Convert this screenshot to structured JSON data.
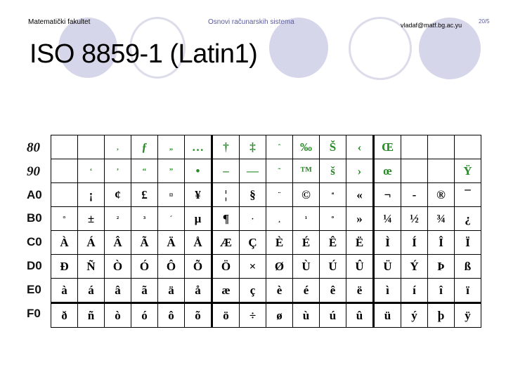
{
  "header": {
    "left": "Matematički fakultet",
    "center": "Osnovi računarskih sistema",
    "right": "vladaf@matf.bg.ac.yu",
    "page": "20/5"
  },
  "title": "ISO 8859-1 (Latin1)",
  "colors": {
    "accent_circle": "#d6d6ea",
    "cp1252_extension": "#2a8a2a",
    "text": "#000000"
  },
  "table": {
    "rows": [
      {
        "label": "80",
        "green": true,
        "cells": [
          "",
          "",
          "‚",
          "ƒ",
          "„",
          "…",
          "†",
          "‡",
          "ˆ",
          "‰",
          "Š",
          "‹",
          "Œ",
          "",
          "",
          ""
        ]
      },
      {
        "label": "90",
        "green": true,
        "cells": [
          "",
          "‘",
          "’",
          "“",
          "”",
          "•",
          "–",
          "—",
          "˜",
          "™",
          "š",
          "›",
          "œ",
          "",
          "",
          "Ÿ"
        ]
      },
      {
        "label": "A0",
        "green": false,
        "cells": [
          "",
          "¡",
          "¢",
          "£",
          "¤",
          "¥",
          "¦",
          "§",
          "¨",
          "©",
          "ª",
          "«",
          "¬",
          "-",
          "®",
          "¯"
        ]
      },
      {
        "label": "B0",
        "green": false,
        "cells": [
          "°",
          "±",
          "²",
          "³",
          "´",
          "µ",
          "¶",
          "·",
          "¸",
          "¹",
          "º",
          "»",
          "¼",
          "½",
          "¾",
          "¿"
        ]
      },
      {
        "label": "C0",
        "green": false,
        "cells": [
          "À",
          "Á",
          "Â",
          "Ã",
          "Ä",
          "Å",
          "Æ",
          "Ç",
          "È",
          "É",
          "Ê",
          "Ë",
          "Ì",
          "Í",
          "Î",
          "Ï"
        ]
      },
      {
        "label": "D0",
        "green": false,
        "cells": [
          "Ð",
          "Ñ",
          "Ò",
          "Ó",
          "Ô",
          "Õ",
          "Ö",
          "×",
          "Ø",
          "Ù",
          "Ú",
          "Û",
          "Ü",
          "Ý",
          "Þ",
          "ß"
        ]
      },
      {
        "label": "E0",
        "green": false,
        "cells": [
          "à",
          "á",
          "â",
          "ã",
          "ä",
          "å",
          "æ",
          "ç",
          "è",
          "é",
          "ê",
          "ë",
          "ì",
          "í",
          "î",
          "ï"
        ]
      },
      {
        "label": "F0",
        "green": false,
        "cells": [
          "ð",
          "ñ",
          "ò",
          "ó",
          "ô",
          "õ",
          "ö",
          "÷",
          "ø",
          "ù",
          "ú",
          "û",
          "ü",
          "ý",
          "þ",
          "ÿ"
        ]
      }
    ]
  }
}
